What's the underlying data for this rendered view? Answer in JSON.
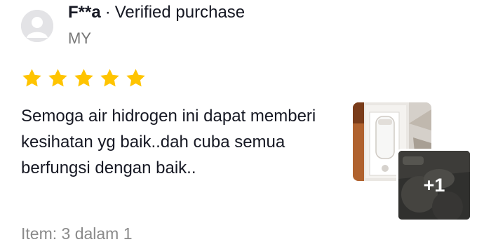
{
  "reviewer": {
    "name": "F**a",
    "separator": "·",
    "badge": "Verified purchase",
    "country": "MY"
  },
  "rating": {
    "value": 5,
    "max": 5,
    "star_color": "#FFC400"
  },
  "review": {
    "text": "Semoga air hidrogen ini dapat memberi kesihatan yg baik..dah cuba semua berfungsi dengan baik..",
    "item": "Item: 3 dalam 1"
  },
  "media": {
    "more_count": "+1"
  },
  "icons": {
    "avatar": "default-user-avatar",
    "star": "star-filled-icon"
  }
}
